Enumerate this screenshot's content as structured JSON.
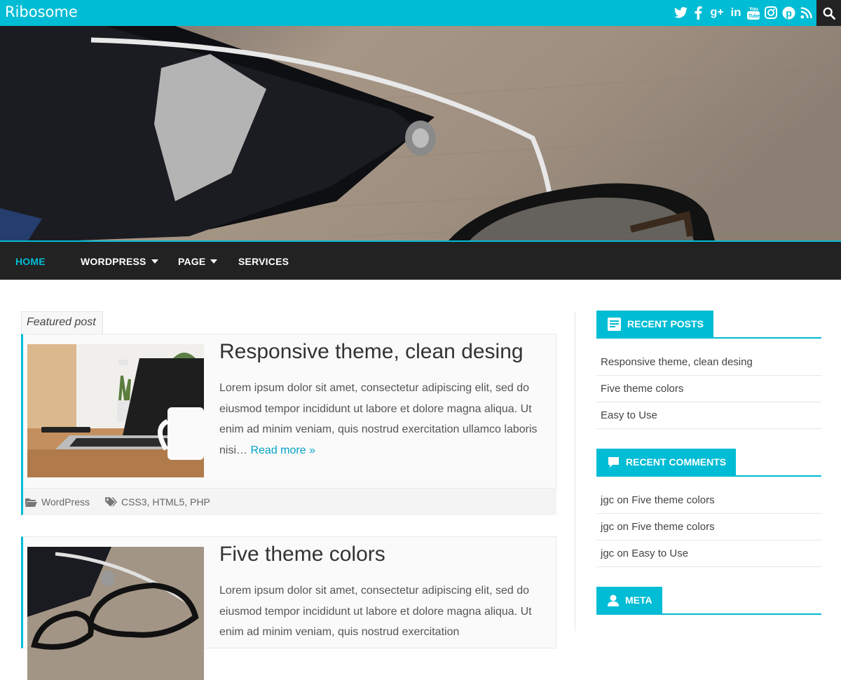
{
  "site": {
    "title": "Ribosome"
  },
  "social_icons": [
    "twitter-icon",
    "facebook-icon",
    "google-plus-icon",
    "linkedin-icon",
    "youtube-icon",
    "instagram-icon",
    "pinterest-icon",
    "rss-icon"
  ],
  "social_glyphs": [
    "𝕥",
    "f",
    "g+",
    "in",
    "▶",
    "◎",
    "ⓟ",
    "⌁"
  ],
  "nav": {
    "items": [
      {
        "label": "HOME",
        "active": true,
        "has_dropdown": false
      },
      {
        "label": "WORDPRESS",
        "active": false,
        "has_dropdown": true
      },
      {
        "label": "PAGE",
        "active": false,
        "has_dropdown": true
      },
      {
        "label": "SERVICES",
        "active": false,
        "has_dropdown": false
      }
    ]
  },
  "featured_label": "Featured post",
  "posts": [
    {
      "title": "Responsive theme, clean desing",
      "excerpt": "Lorem ipsum dolor sit amet, consectetur adipiscing elit, sed do eiusmod tempor incididunt ut labore et dolore magna aliqua. Ut enim ad minim veniam, quis nostrud exercitation ullamco laboris nisi…",
      "read_more": "Read more »",
      "category": "WordPress",
      "tags": "CSS3, HTML5, PHP"
    },
    {
      "title": "Five theme colors",
      "excerpt": "Lorem ipsum dolor sit amet, consectetur adipiscing elit, sed do eiusmod tempor incididunt ut labore et dolore magna aliqua. Ut enim ad minim veniam, quis nostrud exercitation"
    }
  ],
  "sidebar": {
    "recent_posts": {
      "title": "RECENT POSTS",
      "items": [
        "Responsive theme, clean desing",
        "Five theme colors",
        "Easy to Use"
      ]
    },
    "recent_comments": {
      "title": "RECENT COMMENTS",
      "items": [
        "jgc on Five theme colors",
        "jgc on Five theme colors",
        "jgc on Easy to Use"
      ]
    },
    "meta": {
      "title": "META"
    }
  },
  "colors": {
    "accent": "#00bcd4",
    "nav_bg": "#222222",
    "link": "#00a3c4"
  }
}
